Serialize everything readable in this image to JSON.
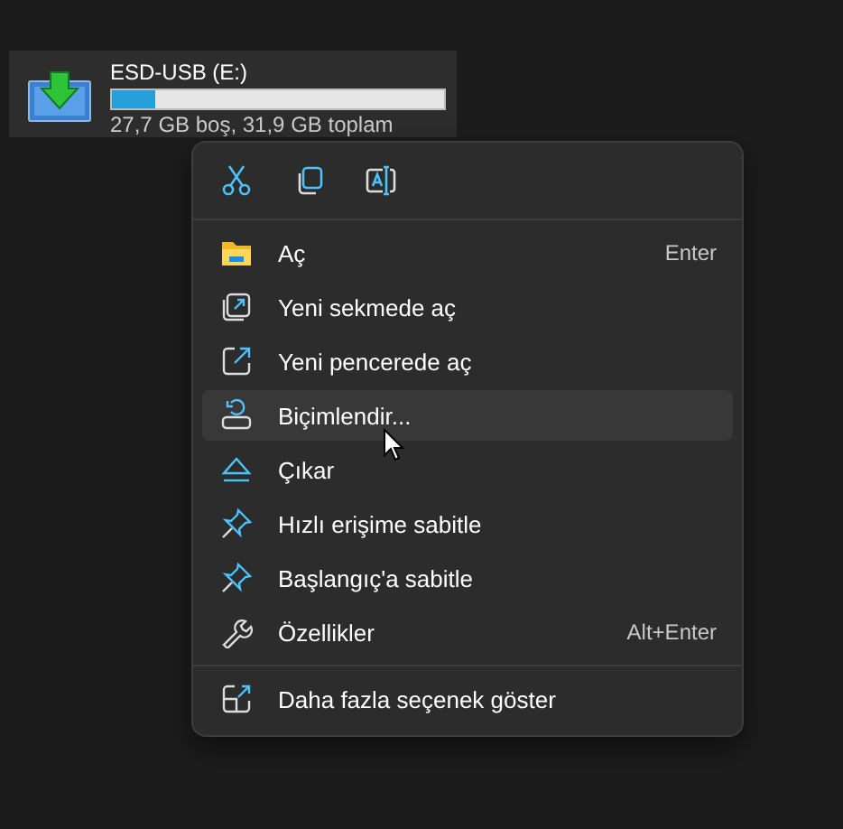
{
  "drive": {
    "name": "ESD-USB (E:)",
    "level": 0.13,
    "space": "27,7 GB boş, 31,9 GB toplam",
    "selected": true
  },
  "context_menu": {
    "toolbar": [
      {
        "kind": "cut"
      },
      {
        "kind": "copy"
      },
      {
        "kind": "rename"
      }
    ],
    "items": [
      {
        "label": "Aç",
        "shortcut": "Enter",
        "kind": "open",
        "selected": false
      },
      {
        "label": "Yeni sekmede aç",
        "kind": "tab",
        "selected": false
      },
      {
        "label": "Yeni pencerede aç",
        "kind": "window",
        "selected": false
      },
      {
        "label": "Biçimlendir...",
        "kind": "format",
        "selected": true
      },
      {
        "label": "Çıkar",
        "kind": "eject",
        "selected": false
      },
      {
        "label": "Hızlı erişime sabitle",
        "kind": "pin",
        "selected": false
      },
      {
        "label": "Başlangıç'a sabitle",
        "kind": "pin",
        "selected": false
      },
      {
        "label": "Özellikler",
        "shortcut": "Alt+Enter",
        "kind": "properties",
        "selected": false
      }
    ],
    "footer_item": {
      "label": "Daha fazla seçenek göster",
      "kind": "more",
      "selected": false
    }
  }
}
